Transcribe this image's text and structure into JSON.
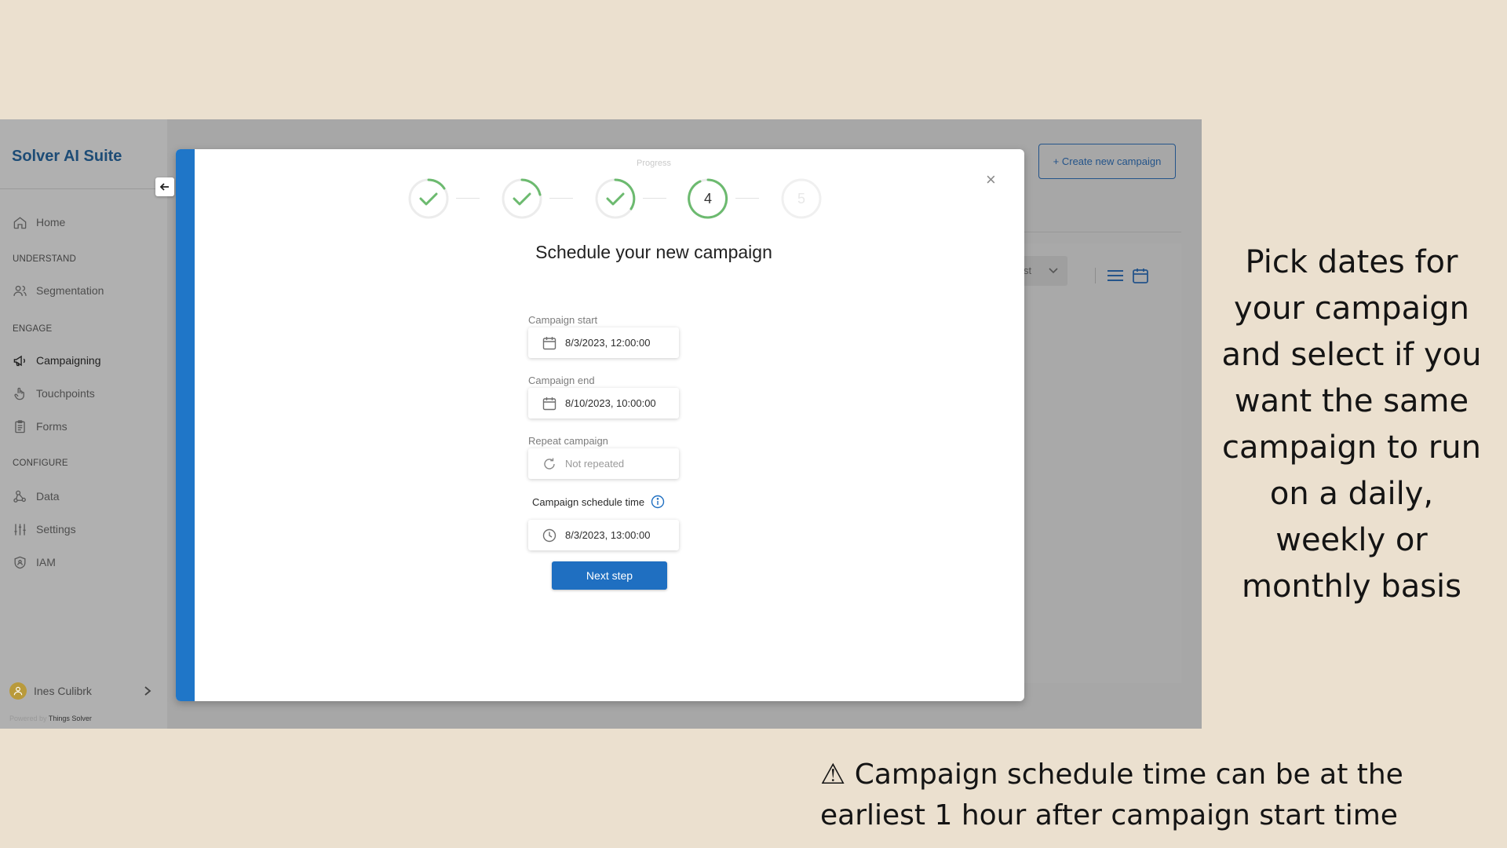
{
  "app": {
    "brand": "Solver AI Suite",
    "nav": {
      "home": "Home",
      "section_understand": "UNDERSTAND",
      "segmentation": "Segmentation",
      "section_engage": "ENGAGE",
      "campaigning": "Campaigning",
      "touchpoints": "Touchpoints",
      "forms": "Forms",
      "section_configure": "CONFIGURE",
      "data": "Data",
      "settings": "Settings",
      "iam": "IAM"
    },
    "user_name": "Ines Culibrk",
    "powered_by": "Powered by",
    "powered_by_company": "Things Solver",
    "create_campaign_button": "+ Create new campaign",
    "background_select_fragment": "st"
  },
  "modal": {
    "progress_label": "Progress",
    "steps": [
      {
        "label": "",
        "state": "done"
      },
      {
        "label": "",
        "state": "done"
      },
      {
        "label": "",
        "state": "done"
      },
      {
        "label": "4",
        "state": "current"
      },
      {
        "label": "5",
        "state": "pending"
      }
    ],
    "title": "Schedule your new campaign",
    "campaign_start_label": "Campaign start",
    "campaign_start_value": "8/3/2023, 12:00:00",
    "campaign_end_label": "Campaign end",
    "campaign_end_value": "8/10/2023, 10:00:00",
    "repeat_label": "Repeat campaign",
    "repeat_placeholder": "Not repeated",
    "schedule_time_label": "Campaign schedule time",
    "schedule_time_value": "8/3/2023, 13:00:00",
    "next_button": "Next step"
  },
  "annotations": {
    "side_note": "Pick dates for your campaign and select if you want the same campaign to run on a daily, weekly or monthly basis",
    "warning_icon": "⚠",
    "warning_note": "Campaign schedule time can be at the earliest 1 hour after campaign start time"
  },
  "colors": {
    "background": "#ebe0cf",
    "brand": "#1d4c76",
    "accent": "#1f76c8",
    "step_done": "#6cba6f"
  },
  "icons": [
    "home-icon",
    "users-icon",
    "megaphone-icon",
    "hand-icon",
    "clipboard-icon",
    "data-icon",
    "sliders-icon",
    "shield-icon",
    "calendar-icon",
    "refresh-icon",
    "clock-icon",
    "info-icon",
    "check-icon",
    "close-icon",
    "arrow-left-icon",
    "chevron-right-icon",
    "list-icon"
  ]
}
